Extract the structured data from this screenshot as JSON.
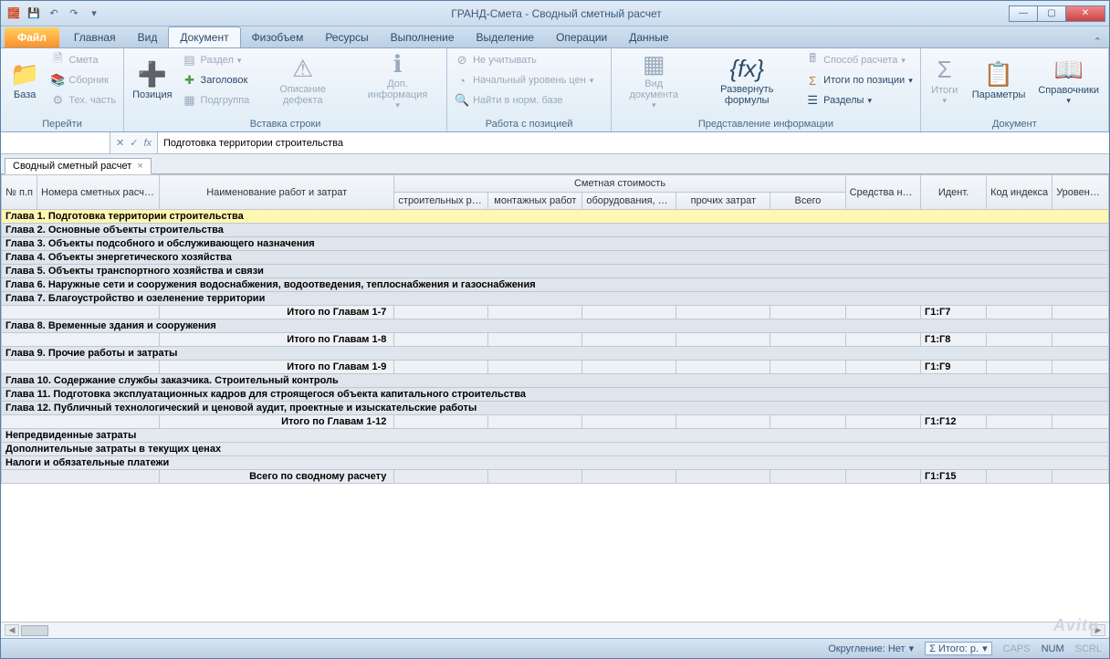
{
  "window": {
    "title": "ГРАНД-Смета - Сводный сметный расчет"
  },
  "qat": {
    "undo": "↶",
    "redo": "↷",
    "save": "💾",
    "app": "🧱",
    "dd": "▾"
  },
  "ribbon": {
    "file": "Файл",
    "tabs": [
      "Главная",
      "Вид",
      "Документ",
      "Физобъем",
      "Ресурсы",
      "Выполнение",
      "Выделение",
      "Операции",
      "Данные"
    ],
    "active": 2,
    "groups": {
      "goto": {
        "label": "Перейти",
        "base": "База",
        "smeta": "Смета",
        "sbornik": "Сборник",
        "tech": "Тех. часть"
      },
      "insert": {
        "label": "Вставка строки",
        "position": "Позиция",
        "razdel": "Раздел",
        "zagolovok": "Заголовок",
        "podgruppa": "Подгруппа",
        "defect": "Описание дефекта",
        "dop": "Доп. информация"
      },
      "workpos": {
        "label": "Работа с позицией",
        "neuch": "Не учитывать",
        "nach": "Начальный уровень цен",
        "find": "Найти в норм. базе"
      },
      "presentation": {
        "label": "Представление информации",
        "viddoc": "Вид документа",
        "expand": "Развернуть формулы",
        "method": "Способ расчета",
        "itogi": "Итоги по позиции",
        "razdely": "Разделы"
      },
      "document": {
        "label": "Документ",
        "itogi": "Итоги",
        "params": "Параметры",
        "sprav": "Справочники"
      }
    }
  },
  "formula": {
    "fx": "fx",
    "cancel": "✕",
    "ok": "✓",
    "text": "Подготовка территории строительства"
  },
  "sheetTab": "Сводный сметный расчет",
  "headers": {
    "num": "№ п.п",
    "codes": "Номера сметных расчетов и смет",
    "name": "Наименование работ и затрат",
    "cost": "Сметная стоимость",
    "c1": "строительных работ",
    "c2": "монтажных работ",
    "c3": "оборудования, мебели, инвентаря",
    "c4": "прочих затрат",
    "total": "Всего",
    "labor": "Средства на оплату труда",
    "ident": "Идент.",
    "index": "Код индекса",
    "level": "Уровень цен"
  },
  "rows": [
    {
      "t": "chapter",
      "sel": true,
      "text": "Глава 1. Подготовка территории строительства"
    },
    {
      "t": "chapter",
      "text": "Глава 2. Основные объекты строительства"
    },
    {
      "t": "chapter",
      "text": "Глава 3. Объекты подсобного и обслуживающего назначения"
    },
    {
      "t": "chapter",
      "text": "Глава 4. Объекты энергетического хозяйства"
    },
    {
      "t": "chapter",
      "text": "Глава 5. Объекты транспортного хозяйства и связи"
    },
    {
      "t": "chapter",
      "text": "Глава 6. Наружные сети и сооружения водоснабжения, водоотведения, теплоснабжения и газоснабжения"
    },
    {
      "t": "chapter",
      "text": "Глава 7. Благоустройство и озеленение территории"
    },
    {
      "t": "subtotal",
      "text": "Итого по Главам 1-7",
      "ident": "Г1:Г7"
    },
    {
      "t": "chapter",
      "text": "Глава 8. Временные здания и сооружения"
    },
    {
      "t": "subtotal",
      "text": "Итого по Главам 1-8",
      "ident": "Г1:Г8"
    },
    {
      "t": "chapter",
      "text": "Глава 9. Прочие работы и затраты"
    },
    {
      "t": "subtotal",
      "text": "Итого по Главам 1-9",
      "ident": "Г1:Г9"
    },
    {
      "t": "chapter",
      "text": "Глава 10. Содержание службы заказчика. Строительный контроль"
    },
    {
      "t": "chapter",
      "text": "Глава 11. Подготовка эксплуатационных кадров для строящегося объекта капитального строительства"
    },
    {
      "t": "chapter",
      "text": "Глава 12. Публичный технологический и ценовой аудит, проектные и изыскательские работы"
    },
    {
      "t": "subtotal",
      "text": "Итого по Главам 1-12",
      "ident": "Г1:Г12"
    },
    {
      "t": "section",
      "text": "Непредвиденные затраты"
    },
    {
      "t": "section",
      "text": "Дополнительные затраты в текущих ценах"
    },
    {
      "t": "section",
      "text": "Налоги и обязательные платежи"
    },
    {
      "t": "grand",
      "text": "Всего по сводному расчету",
      "ident": "Г1:Г15"
    }
  ],
  "status": {
    "round": "Округление: Нет",
    "sum": "Σ Итого: р.",
    "caps": "CAPS",
    "num": "NUM",
    "scrl": "SCRL"
  },
  "watermark": "Avito"
}
